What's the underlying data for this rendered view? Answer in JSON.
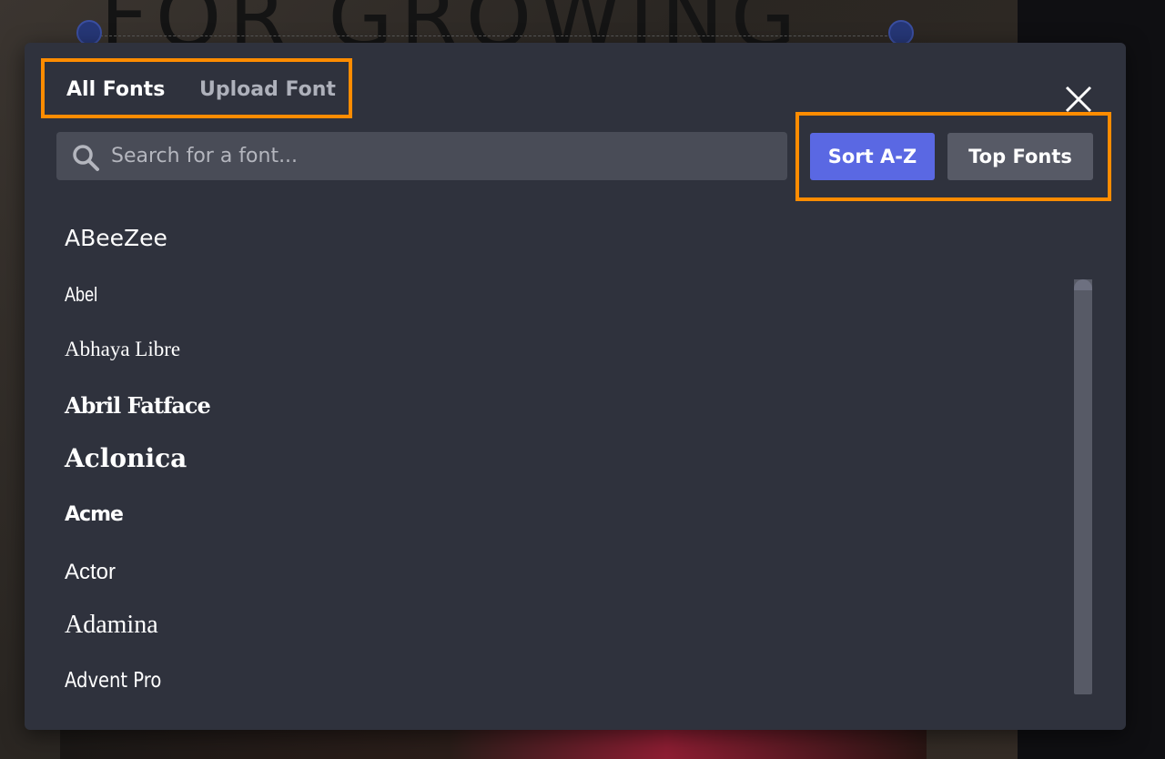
{
  "background": {
    "headline": "FOR GROWING"
  },
  "tabs": {
    "all_fonts": "All Fonts",
    "upload_font": "Upload Font"
  },
  "search": {
    "placeholder": "Search for a font...",
    "value": ""
  },
  "sort": {
    "sort_az_label": "Sort A-Z",
    "top_fonts_label": "Top Fonts"
  },
  "fonts": [
    "ABeeZee",
    "Abel",
    "Abhaya Libre",
    "Abril Fatface",
    "Aclonica",
    "Acme",
    "Actor",
    "Adamina",
    "Advent Pro"
  ],
  "colors": {
    "highlight": "#ff8c00",
    "primary_button": "#5a68e3",
    "modal_bg": "#2f323d"
  },
  "icons": {
    "close": "close-icon",
    "search": "search-icon"
  }
}
